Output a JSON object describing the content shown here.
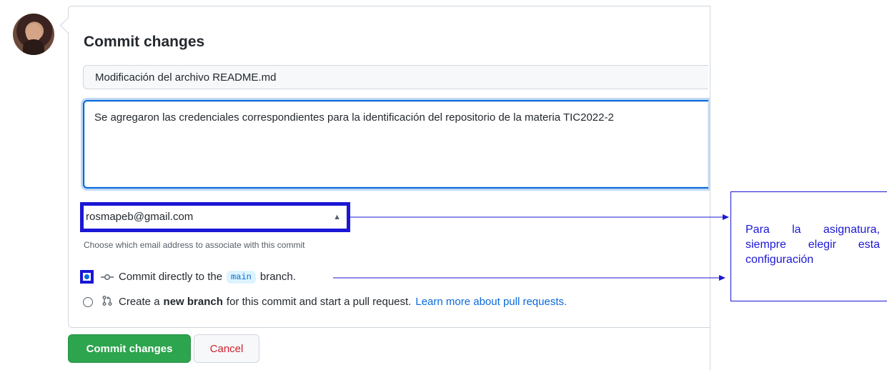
{
  "commit_form": {
    "title": "Commit changes",
    "summary_value": "Modificación del archivo README.md",
    "description_value": "Se agregaron las credenciales correspondientes para la identificación del repositorio de la materia TIC2022-2",
    "email_selected": "rosmapeb@gmail.com",
    "email_hint": "Choose which email address to associate with this commit",
    "option_direct": {
      "prefix": "Commit directly to the",
      "branch": "main",
      "suffix": "branch."
    },
    "option_new_branch": {
      "prefix": "Create a",
      "bold": "new branch",
      "suffix": "for this commit and start a pull request.",
      "link": "Learn more about pull requests."
    },
    "commit_button": "Commit changes",
    "cancel_button": "Cancel"
  },
  "annotation": {
    "text": "Para la asignatura, siempre elegir esta configuración"
  },
  "colors": {
    "annotation_blue": "#1b17d4",
    "primary_green": "#2da44e",
    "link_blue": "#0969da",
    "cancel_red": "#cf222e"
  },
  "icons": {
    "commit": "git-commit-icon",
    "pull_request": "git-pull-request-icon",
    "select": "select-chevrons-icon"
  }
}
